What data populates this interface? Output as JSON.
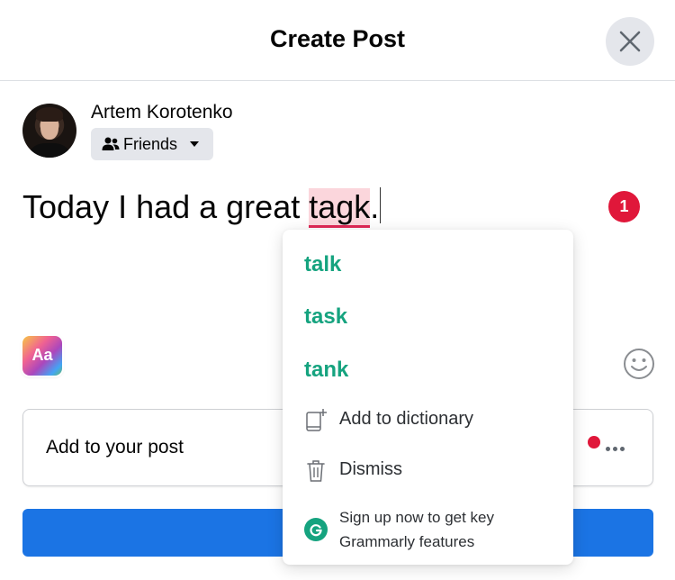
{
  "dialog": {
    "title": "Create Post"
  },
  "user": {
    "name": "Artem Korotenko",
    "audience": "Friends"
  },
  "composer": {
    "text_before": "Today I had a great ",
    "typo_word": "tagk",
    "text_after": ".",
    "issue_count": "1",
    "text_style_label": "Aa"
  },
  "add_to_post": {
    "label": "Add to your post"
  },
  "grammarly_popup": {
    "suggestions": [
      "talk",
      "task",
      "tank"
    ],
    "add_to_dictionary": "Add to dictionary",
    "dismiss": "Dismiss",
    "signup_line1": "Sign up now to get key",
    "signup_line2": "Grammarly features"
  },
  "colors": {
    "accent_blue": "#1b74e4",
    "grammarly_green": "#15a37f",
    "error_red": "#e0173a",
    "typo_highlight": "#fbd6dc"
  },
  "icons": {
    "close": "close-icon",
    "audience": "friends-icon",
    "audience_caret": "caret-down-icon",
    "emoji": "smiley-icon",
    "more": "more-horizontal-icon",
    "dictionary": "add-to-dictionary-icon",
    "dismiss": "trash-icon",
    "grammarly": "grammarly-logo-icon"
  }
}
